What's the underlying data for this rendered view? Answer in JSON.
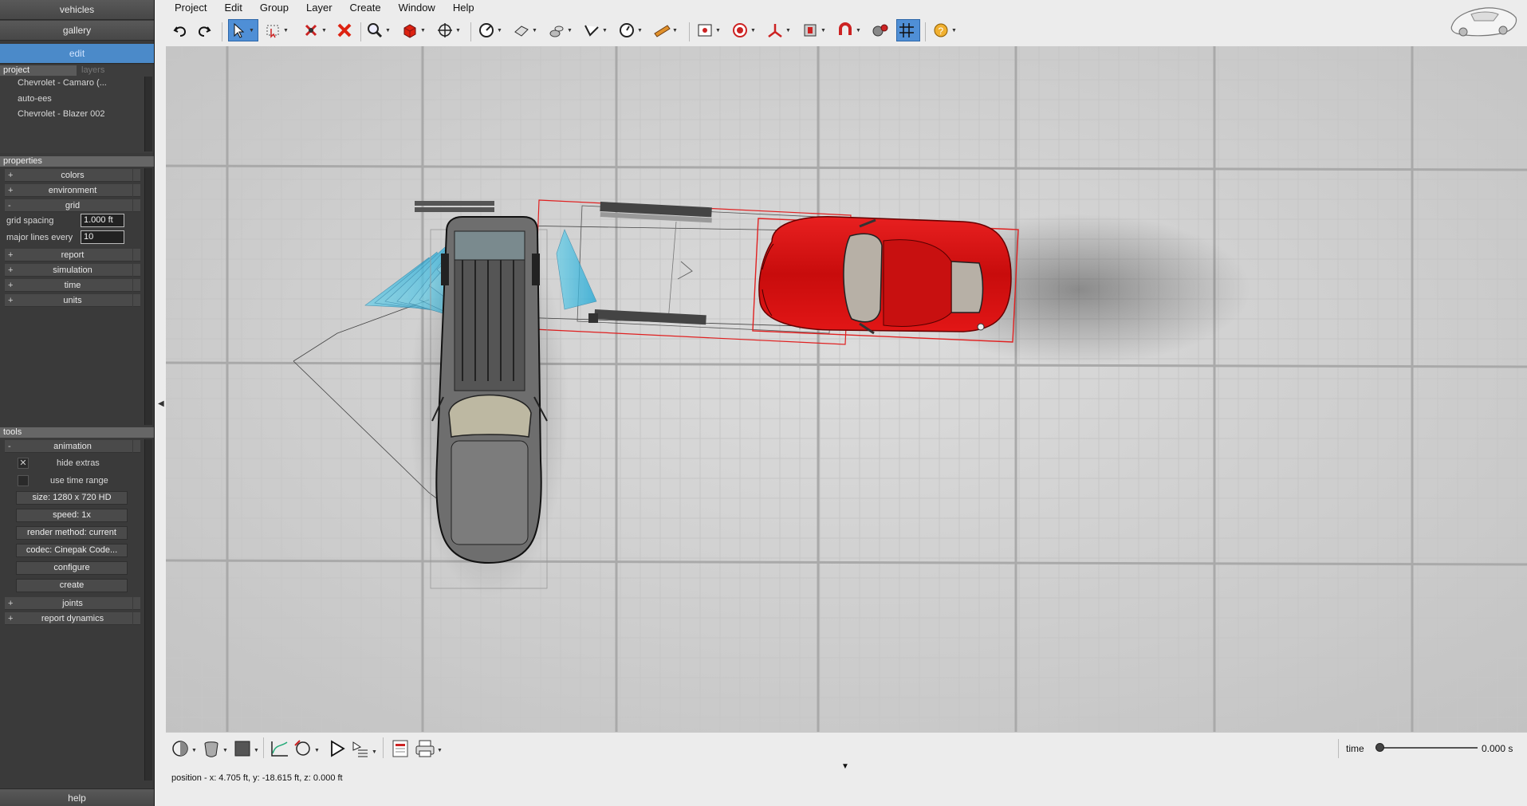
{
  "nav": {
    "vehicles": "vehicles",
    "gallery": "gallery",
    "edit": "edit"
  },
  "project_panel": {
    "tab_project": "project",
    "tab_layers": "layers",
    "items": [
      "Chevrolet - Camaro (...",
      "auto-ees",
      "Chevrolet - Blazer 002"
    ]
  },
  "properties": {
    "header": "properties",
    "colors": "colors",
    "environment": "environment",
    "grid": "grid",
    "grid_spacing_label": "grid spacing",
    "grid_spacing_value": "1.000 ft",
    "major_lines_label": "major lines every",
    "major_lines_value": "10",
    "report": "report",
    "simulation": "simulation",
    "time": "time",
    "units": "units",
    "plus": "+",
    "minus": "-"
  },
  "tools": {
    "header": "tools",
    "animation": "animation",
    "hide_extras": "hide extras",
    "hide_extras_check": "✕",
    "use_time_range": "use time range",
    "size": "size: 1280 x 720 HD",
    "speed": "speed: 1x",
    "render_method": "render method: current",
    "codec": "codec: Cinepak Code...",
    "configure": "configure",
    "create": "create",
    "joints": "joints",
    "report_dynamics": "report dynamics"
  },
  "help": "help",
  "menu": [
    "Project",
    "Edit",
    "Group",
    "Layer",
    "Create",
    "Window",
    "Help"
  ],
  "timeline": {
    "label": "time",
    "value": "0.000 s",
    "position": 0
  },
  "status": "position - x: 4.705 ft, y: -18.615 ft, z: 0.000 ft",
  "colors": {
    "accent": "#4b8ac9",
    "camaro": "#d41212",
    "selection": "#e02020",
    "grid_major": "#a8a8a8",
    "viewport": "#d3d3d3"
  },
  "icons": [
    "undo-icon",
    "redo-icon",
    "select-arrow-icon",
    "select-box-icon",
    "delete-node-icon",
    "delete-icon",
    "zoom-icon",
    "cube-icon",
    "move-icon",
    "measure-icon",
    "surface-icon",
    "light-icon",
    "skid-icon",
    "gauge-icon",
    "ruler-icon",
    "camera-icon",
    "target-icon",
    "axis-icon",
    "render-icon",
    "magnet-icon",
    "settings-icon",
    "grid-icon",
    "help-icon"
  ]
}
